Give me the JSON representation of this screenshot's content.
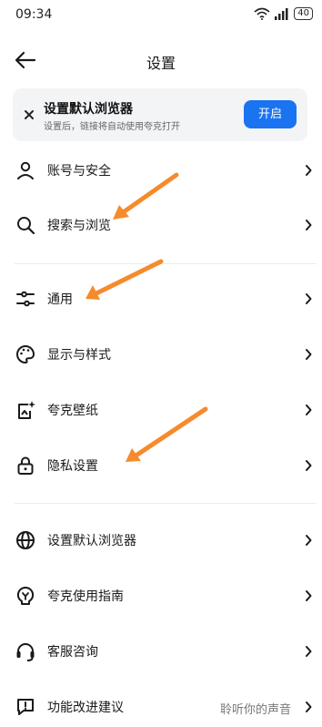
{
  "status": {
    "time": "09:34",
    "battery": "40"
  },
  "header": {
    "title": "设置"
  },
  "banner": {
    "title": "设置默认浏览器",
    "subtitle": "设置后，链接将自动使用夸克打开",
    "button": "开启"
  },
  "groups": [
    [
      {
        "label": "账号与安全",
        "icon": "user-icon"
      },
      {
        "label": "搜索与浏览",
        "icon": "search-icon"
      }
    ],
    [
      {
        "label": "通用",
        "icon": "sliders-icon"
      },
      {
        "label": "显示与样式",
        "icon": "palette-icon"
      },
      {
        "label": "夸克壁纸",
        "icon": "wallpaper-icon"
      },
      {
        "label": "隐私设置",
        "icon": "lock-icon"
      }
    ],
    [
      {
        "label": "设置默认浏览器",
        "icon": "globe-icon"
      },
      {
        "label": "夸克使用指南",
        "icon": "guide-icon"
      },
      {
        "label": "客服咨询",
        "icon": "headset-icon"
      },
      {
        "label": "功能改进建议",
        "icon": "feedback-icon",
        "extra": "聆听你的声音"
      }
    ]
  ],
  "colors": {
    "accent": "#1a73f0",
    "annotation": "#f58b2c"
  }
}
